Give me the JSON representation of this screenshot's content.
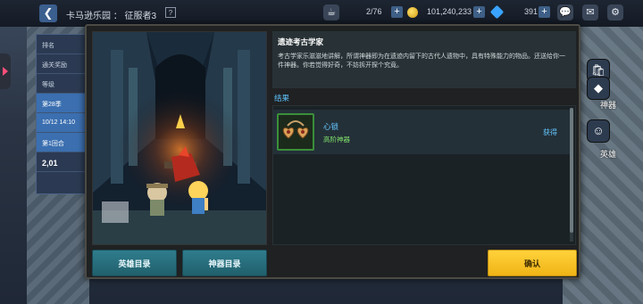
{
  "topbar": {
    "title": "卡马逊乐园 ： 征服者3",
    "help": "?",
    "stamina": "2/76",
    "gold": "101,240,233",
    "gems": "391",
    "plus": "+"
  },
  "leftpanel": {
    "rows": [
      "排名",
      "通关奖励",
      "等级",
      "第28季",
      "10/12 14:10",
      "第1回合",
      "2,01"
    ]
  },
  "side_menu": {
    "artifact_label": "神器",
    "hero_label": "英雄"
  },
  "dialog": {
    "desc_title": "遗迹考古学家",
    "desc_text": "考古学家乐滋滋地讲解，所谓神器即为在遗迹内留下的古代人遗物中，具有特殊能力的物品。还送给你一件神器。你若觉得好奇，不妨拆开探个究竟。",
    "result_label": "结果",
    "item_name": "心锁",
    "item_grade": "高阶神器",
    "item_status": "获得",
    "btn_heroes": "英雄目录",
    "btn_artifacts": "神器目录",
    "btn_confirm": "确认"
  },
  "colors": {
    "accent_blue": "#63c6ff",
    "grade_green": "#7ee06a",
    "confirm_yellow": "#ffd23b",
    "teal_button": "#2f7d8e"
  }
}
